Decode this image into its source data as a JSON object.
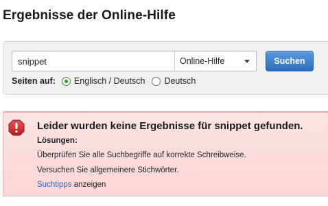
{
  "page": {
    "title": "Ergebnisse der Online-Hilfe"
  },
  "search": {
    "query": "snippet",
    "scope_selected": "Online-Hilfe",
    "button_label": "Suchen"
  },
  "scope": {
    "label": "Seiten auf:",
    "options": [
      {
        "label": "Englisch / Deutsch",
        "checked": true
      },
      {
        "label": "Deutsch",
        "checked": false
      }
    ]
  },
  "alert": {
    "title": "Leider wurden keine Ergebnisse für snippet gefunden.",
    "subtitle": "Lösungen:",
    "suggestions": [
      "Überprüfen Sie alle Suchbegriffe auf korrekte Schreibweise.",
      "Versuchen Sie allgemeinere Stichwörter."
    ],
    "tips_link": "Suchtipps",
    "tips_suffix": " anzeigen",
    "icon": "error-icon",
    "colors": {
      "background": "#fbdcdc",
      "border": "#e6b0b0",
      "icon": "#c62828"
    }
  },
  "colors": {
    "button": "#2b6cb8",
    "link": "#2a67c4",
    "radio_checked": "#2f9a2f"
  }
}
